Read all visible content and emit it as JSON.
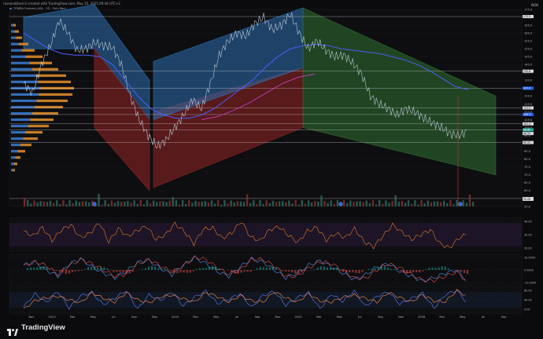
{
  "header": {
    "text": "raveandjhonnii created with TradingView.com, May 15, 2025 09:46 UTC+2"
  },
  "currency": "NOK",
  "legend": [
    {
      "label": "TOMRA Systems ASA · 1D · Oslo Børs",
      "color": "#4a90e2"
    },
    {
      "label": "VRVP (Number Of Rows, 24, Up/Down)",
      "color": "#f5a623"
    },
    {
      "label": "MA (20)",
      "color": "#26a69a"
    },
    {
      "label": "MA (200)",
      "color": "#5b6bff"
    },
    {
      "label": "Vol · 12, 200 · 1.89M",
      "color": "#888888"
    }
  ],
  "pane_labels": {
    "rsi": "RSI (14, close, 14, 2)",
    "macd": "MACD (12, 26, close, 9, EMA, EMA)",
    "stoch": "Stoch (14, 3, 3)"
  },
  "brand": "TradingView",
  "colors": {
    "blue_channel": "#2d6fb0",
    "red_channel": "#8b2323",
    "green_channel": "#2f6b2f",
    "price": "#b9c8d6",
    "ma200": "#4b5cff",
    "ma20": "#c040c0",
    "volume_profile_up": "#e8912a",
    "volume_profile_down": "#3b7dd8",
    "current_price": "#26a69a"
  },
  "chart_data": [
    {
      "type": "line",
      "title": "TOMRA Systems ASA, 1D",
      "x": [
        "Nov",
        "2023",
        "Mar",
        "May",
        "Jul",
        "Sep",
        "Nov",
        "2024",
        "Mar",
        "May",
        "Jul",
        "Sep",
        "Nov",
        "2025",
        "Mar",
        "May",
        "Jul",
        "Sep",
        "Nov",
        "2026",
        "Mar",
        "May",
        "Jul",
        "Sep"
      ],
      "y_ticks": [
        "175.0",
        "170.0",
        "165.0",
        "160.0",
        "155.0",
        "150.0",
        "145.0",
        "140.0",
        "135.0",
        "130.0",
        "125.0",
        "120.0",
        "115.0",
        "110.0",
        "105.0",
        "100.0",
        "95.0",
        "90.0",
        "85.0",
        "80.0",
        "75.0",
        "70.0",
        "65.0",
        "60.0",
        "55.0",
        "50.0"
      ],
      "ylim": [
        50,
        175
      ],
      "price_labels": [
        "170.5",
        "135.8",
        "125.0",
        "112.5",
        "108.3",
        "102.4",
        "98.60",
        "96.25",
        "90.52",
        "55.00",
        "54.50"
      ],
      "series": [
        {
          "name": "Price",
          "values": [
            128,
            122,
            140,
            152,
            168,
            160,
            149,
            150,
            154,
            152,
            151,
            140,
            120,
            105,
            95,
            88,
            92,
            100,
            108,
            118,
            112,
            128,
            146,
            155,
            160,
            158,
            166,
            170,
            162,
            165,
            172,
            160,
            150,
            155,
            149,
            145,
            146,
            141,
            134,
            120,
            115,
            112,
            108,
            112,
            110,
            106,
            103,
            100,
            96,
            95,
            98
          ]
        },
        {
          "name": "MA (200)",
          "values": [
            160,
            155,
            150,
            147,
            146,
            146,
            145,
            140,
            130,
            120,
            112,
            108,
            106,
            106,
            108,
            112,
            118,
            124,
            130,
            138,
            145,
            150,
            152,
            153,
            152,
            150,
            149,
            148,
            147,
            145,
            143,
            140,
            136,
            131,
            126,
            124
          ]
        },
        {
          "name": "MA (20)",
          "values": [
            null,
            null,
            null,
            null,
            null,
            null,
            null,
            null,
            null,
            null,
            null,
            105,
            107,
            111,
            116,
            122,
            128,
            132,
            134
          ]
        }
      ],
      "channels": [
        {
          "name": "Blue up-channel 1",
          "color": "blue"
        },
        {
          "name": "Red down-channel 1",
          "color": "red"
        },
        {
          "name": "Red up-channel 2",
          "color": "red"
        },
        {
          "name": "Blue up-channel 2",
          "color": "blue"
        },
        {
          "name": "Green down-channel",
          "color": "green"
        }
      ],
      "horizontal_levels": [
        170.5,
        135.8,
        125.0,
        112.5,
        108.3,
        102.4,
        98.6,
        90.52,
        55.0
      ]
    },
    {
      "type": "line",
      "title": "RSI (14, close, 14, 2)",
      "y_ticks": [
        "40.00",
        "30.00",
        "20.00"
      ],
      "values": [
        55,
        48,
        62,
        40,
        58,
        66,
        45,
        52,
        70,
        38,
        60,
        47,
        57,
        64,
        42,
        50,
        68,
        55,
        35,
        59,
        61,
        44,
        53,
        72,
        46,
        40,
        58,
        63,
        49,
        37,
        56,
        62,
        41,
        52,
        45,
        60,
        38,
        30,
        48,
        66,
        54,
        42,
        50,
        58,
        35,
        28,
        44,
        52
      ]
    },
    {
      "type": "line",
      "title": "MACD (12, 26, close, 9, EMA, EMA)",
      "y_ticks": [
        "10.0000",
        "0.0000",
        "-10.0000"
      ],
      "series": [
        {
          "name": "MACD",
          "values": [
            2,
            4,
            -1,
            -5,
            3,
            6,
            1,
            -3,
            -6,
            -2,
            4,
            5,
            0,
            -4,
            2,
            7,
            3,
            -2,
            -5,
            1,
            6,
            4,
            -1,
            -6,
            -3,
            2,
            5,
            1,
            -3,
            -7,
            -4,
            1,
            3,
            -2,
            -5,
            -8,
            -6,
            -3,
            -1,
            -9
          ]
        },
        {
          "name": "Signal",
          "values": [
            1,
            3,
            1,
            -3,
            1,
            4,
            2,
            -1,
            -4,
            -3,
            2,
            4,
            1,
            -2,
            1,
            5,
            4,
            0,
            -3,
            -1,
            4,
            4,
            1,
            -4,
            -4,
            0,
            3,
            2,
            -1,
            -5,
            -5,
            -1,
            2,
            0,
            -3,
            -6,
            -6,
            -4,
            -2,
            -7
          ]
        }
      ]
    },
    {
      "type": "line",
      "title": "Stoch (14, 3, 3)",
      "y_ticks": [
        "80.00",
        "40.00",
        "0.00"
      ],
      "values": [
        20,
        80,
        40,
        90,
        15,
        70,
        85,
        30,
        60,
        95,
        10,
        75,
        50,
        88,
        25,
        65,
        92,
        35,
        55,
        80,
        18,
        72,
        90,
        28,
        62,
        85,
        12,
        78,
        45,
        93,
        22,
        68,
        88,
        33,
        58,
        82,
        15,
        76,
        95,
        30
      ]
    }
  ]
}
